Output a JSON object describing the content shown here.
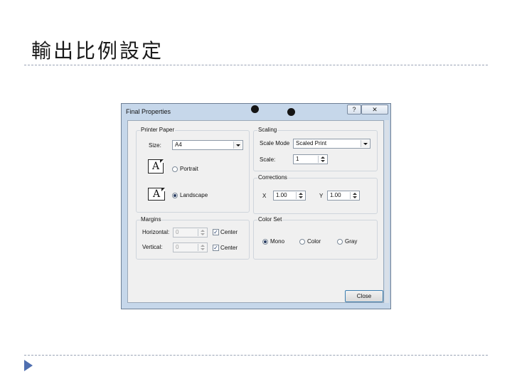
{
  "slide": {
    "title": "輸出比例設定"
  },
  "dialog": {
    "title": "Final Properties",
    "help_glyph": "?",
    "close_glyph": "✕",
    "printer_paper": {
      "group_label": "Printer Paper",
      "size_label": "Size:",
      "size_value": "A4",
      "icon_letter": "A",
      "portrait_label": "Portrait",
      "landscape_label": "Landscape",
      "orientation_selected": "Landscape"
    },
    "margins": {
      "group_label": "Margins",
      "horizontal_label": "Horizontal:",
      "horizontal_value": "0",
      "vertical_label": "Vertical:",
      "vertical_value": "0",
      "center_label": "Center",
      "horizontal_center_checked": true,
      "vertical_center_checked": true,
      "check_glyph": "✓"
    },
    "scaling": {
      "group_label": "Scaling",
      "mode_label": "Scale Mode",
      "mode_value": "Scaled Print",
      "scale_label": "Scale:",
      "scale_value": "1"
    },
    "corrections": {
      "group_label": "Corrections",
      "x_label": "X",
      "x_value": "1.00",
      "y_label": "Y",
      "y_value": "1.00"
    },
    "color_set": {
      "group_label": "Color Set",
      "options": [
        "Mono",
        "Color",
        "Gray"
      ],
      "selected": "Mono"
    },
    "close_button": "Close"
  },
  "colors": {
    "accent_arrow": "#4f6fb0",
    "separator": "#9aa3b5",
    "dialog_frame": "#c6d7ea"
  }
}
